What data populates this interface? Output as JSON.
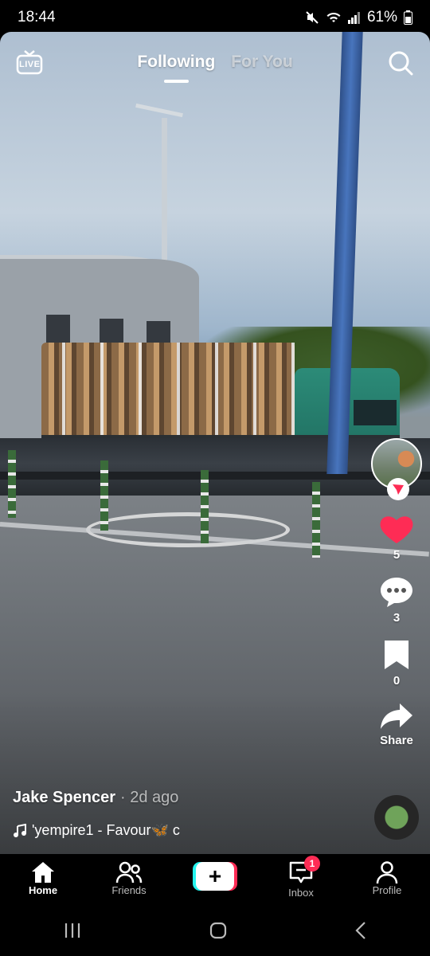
{
  "status_bar": {
    "time": "18:44",
    "battery": "61%"
  },
  "top_nav": {
    "tabs": [
      {
        "label": "Following",
        "active": true
      },
      {
        "label": "For You",
        "active": false
      }
    ],
    "live_label": "LIVE"
  },
  "actions": {
    "likes": "5",
    "comments": "3",
    "saves": "0",
    "share_label": "Share",
    "like_color": "#fe2c55"
  },
  "caption": {
    "author": "Jake Spencer",
    "time": "· 2d ago",
    "music": "'yempire1 - Favour🦋     c"
  },
  "tab_bar": {
    "items": [
      {
        "label": "Home",
        "active": true
      },
      {
        "label": "Friends",
        "active": false
      },
      {
        "label": "",
        "active": false
      },
      {
        "label": "Inbox",
        "active": false,
        "badge": "1"
      },
      {
        "label": "Profile",
        "active": false
      }
    ]
  },
  "colors": {
    "brand_red": "#fe2c55",
    "brand_cyan": "#25f4ee"
  }
}
